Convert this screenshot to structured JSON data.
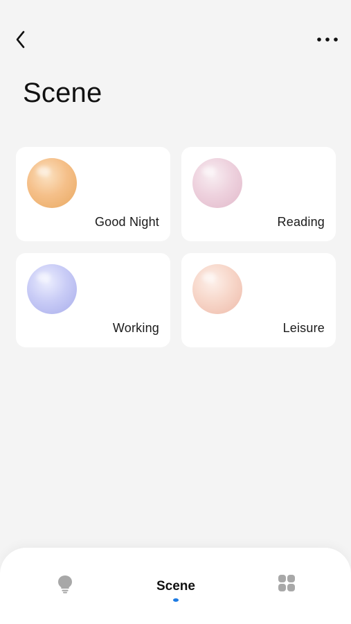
{
  "header": {
    "back_icon": "chevron-left-icon",
    "more_icon": "more-horizontal-icon",
    "title": "Scene"
  },
  "scenes": [
    {
      "label": "Good Night",
      "orb_color": "#F2B97C"
    },
    {
      "label": "Reading",
      "orb_color": "#EDCFDC"
    },
    {
      "label": "Working",
      "orb_color": "#C4C7F4"
    },
    {
      "label": "Leisure",
      "orb_color": "#F5D1C4"
    }
  ],
  "tabbar": {
    "light_icon": "lightbulb-icon",
    "scene_label": "Scene",
    "apps_icon": "grid-icon",
    "active_indicator_color": "#1E7BE3",
    "inactive_icon_color": "#A8A8A8"
  }
}
